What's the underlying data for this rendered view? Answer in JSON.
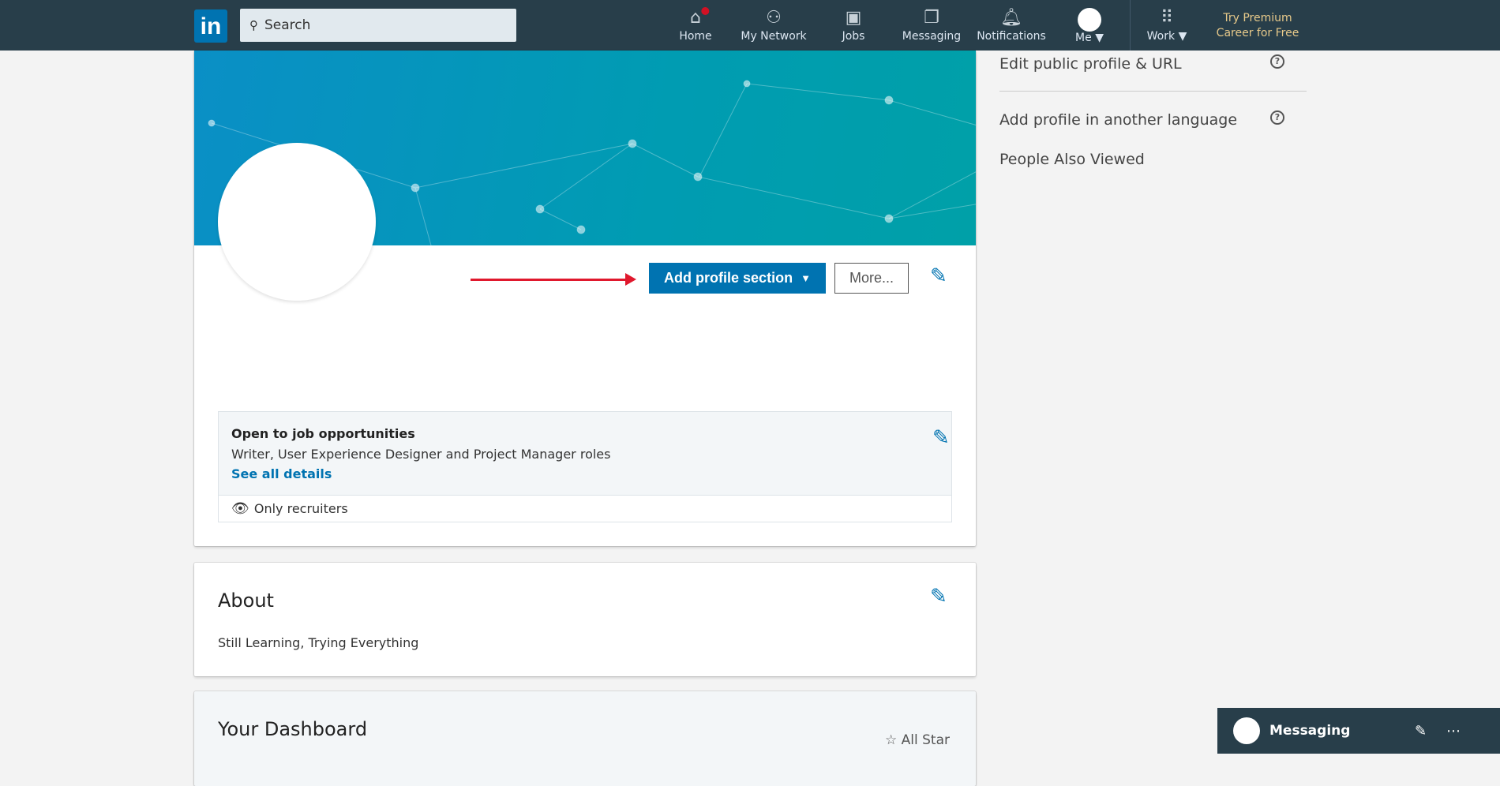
{
  "nav": {
    "logo": "in",
    "search_placeholder": "Search",
    "items": [
      {
        "label": "Home",
        "icon": "home-icon"
      },
      {
        "label": "My Network",
        "icon": "network-icon"
      },
      {
        "label": "Jobs",
        "icon": "briefcase-icon"
      },
      {
        "label": "Messaging",
        "icon": "messaging-icon"
      },
      {
        "label": "Notifications",
        "icon": "bell-icon"
      }
    ],
    "me": "Me",
    "work": "Work",
    "premium_line1": "Try Premium",
    "premium_line2": "Career for Free"
  },
  "profile": {
    "add_section": "Add profile section",
    "more": "More...",
    "open_title": "Open to job opportunities",
    "open_roles": "Writer, User Experience Designer and Project Manager roles",
    "see_details": "See all details",
    "visibility": "Only recruiters"
  },
  "about": {
    "title": "About",
    "text": "Still Learning, Trying Everything"
  },
  "dashboard": {
    "title": "Your Dashboard",
    "badge": "All Star"
  },
  "sidebar": {
    "edit_url": "Edit public profile & URL",
    "add_language": "Add profile in another language",
    "people_viewed": "People Also Viewed"
  },
  "messaging": {
    "label": "Messaging"
  },
  "colors": {
    "nav": "#283e4a",
    "brand": "#0073b1",
    "arrow": "#e0182d"
  }
}
